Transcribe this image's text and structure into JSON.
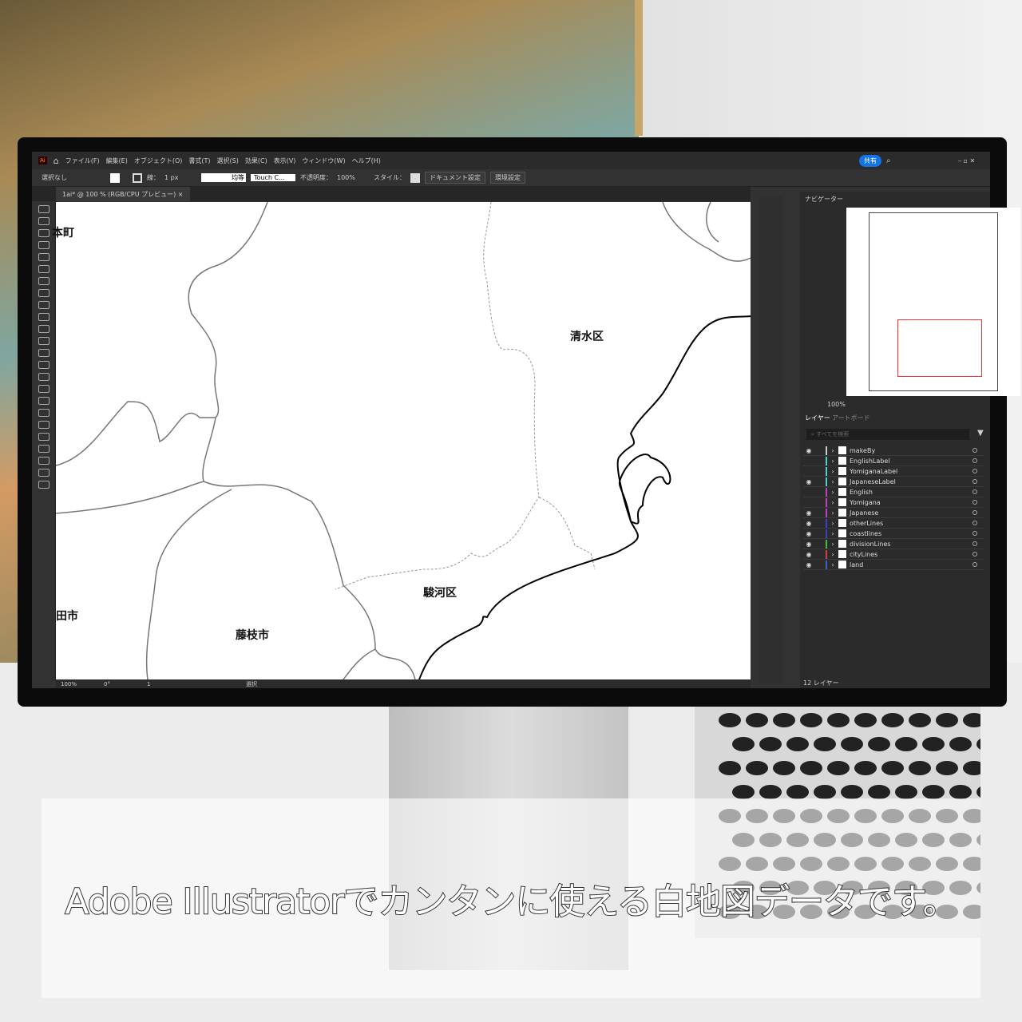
{
  "menubar": {
    "app_icon": "Ai",
    "items": [
      "ファイル(F)",
      "編集(E)",
      "オブジェクト(O)",
      "書式(T)",
      "選択(S)",
      "効果(C)",
      "表示(V)",
      "ウィンドウ(W)",
      "ヘルプ(H)"
    ],
    "share": "共有"
  },
  "control": {
    "selection": "選択なし",
    "stroke_label": "線：",
    "stroke_value": "1 px",
    "profile": "均等",
    "brush": "Touch C...",
    "opacity_label": "不透明度：",
    "opacity": "100%",
    "style_label": "スタイル：",
    "doc_settings": "ドキュメント設定",
    "prefs": "環境設定"
  },
  "document": {
    "tab": "1ai* @ 100 % (RGB/CPU プレビュー)"
  },
  "map": {
    "labels": [
      "清水区",
      "駿河区",
      "藤枝市",
      "田市",
      "本町"
    ]
  },
  "status": {
    "zoom": "100%",
    "rotation": "0°",
    "artboard": "1",
    "tool": "選択"
  },
  "panel": {
    "navigator_tab": "ナビゲーター",
    "nav_zoom": "100%",
    "layers_tab": "レイヤー",
    "artboard_tab": "アートボード",
    "search_placeholder": "すべてを検索",
    "layer_count": "12 レイヤー",
    "layers": [
      {
        "name": "makeBy",
        "visible": true,
        "color": "#cccccc"
      },
      {
        "name": "EnglishLabel",
        "visible": false,
        "color": "#4fd1d1"
      },
      {
        "name": "YomiganaLabel",
        "visible": false,
        "color": "#4fd1d1"
      },
      {
        "name": "JapaneseLabel",
        "visible": true,
        "color": "#4fd1d1"
      },
      {
        "name": "English",
        "visible": false,
        "color": "#c040c0"
      },
      {
        "name": "Yomigana",
        "visible": false,
        "color": "#c040c0"
      },
      {
        "name": "Japanese",
        "visible": true,
        "color": "#c040c0"
      },
      {
        "name": "otherLines",
        "visible": true,
        "color": "#4040c0"
      },
      {
        "name": "coastlines",
        "visible": true,
        "color": "#4040c0"
      },
      {
        "name": "divisionLines",
        "visible": true,
        "color": "#40c040"
      },
      {
        "name": "cityLines",
        "visible": true,
        "color": "#d04040"
      },
      {
        "name": "land",
        "visible": true,
        "color": "#4060d0"
      }
    ]
  },
  "caption": "Adobe Illustratorでカンタンに使える白地図データです。"
}
